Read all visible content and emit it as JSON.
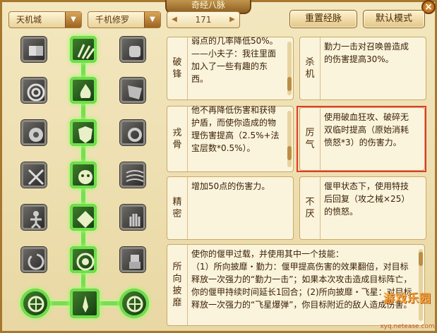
{
  "window": {
    "title": "奇经八脉",
    "close_label": "×"
  },
  "toolbar": {
    "faction_select": "天机城",
    "school_select": "千机修罗",
    "level_value": "171",
    "level_left_arrow": "◀",
    "level_right_arrow": "▶",
    "reset_button": "重置经脉",
    "default_button": "默认模式",
    "dropdown_arrow": "▼"
  },
  "skills": [
    {
      "name": "破锋",
      "text": "弱点的几率降低50%。\n——小夫子：我往里面加入了一些有趣的东西。"
    },
    {
      "name": "杀机",
      "text": "勤力一击对召唤兽造成的伤害提高30%。"
    },
    {
      "name": "戎骨",
      "text": "他不再降低伤害和获得护盾，而使你造成的物理伤害提高（2.5%+法宝层数*0.5%）。"
    },
    {
      "name": "厉气",
      "text": "使用破血狂攻、破碎无双临时提高（原始消耗愤怒*3）的伤害力。"
    },
    {
      "name": "精密",
      "text": "增加50点的伤害力。"
    },
    {
      "name": "不厌",
      "text": "偃甲状态下，使用特技后回复（攻之械×25）的愤怒。"
    },
    {
      "name": "所向披靡",
      "text": "使你的偃甲过载，并使用其中一个技能：\n（1）所向披靡・勤力：偃甲提高伤害的效果翻倍，对目标释放一次强力的“勤力一击”；如果本次攻击造成目标阵亡，你的偃甲持续时间延长1回合；(2)所向披靡・飞星：对目标释放一次强力的“飞星爆弹”，你目标附近的敌人造成伤害。"
    }
  ],
  "watermark": {
    "logo": "游戏乐园",
    "url": "xyq.netease.com"
  },
  "icons": [
    "book-icon",
    "claw-icon",
    "fist-icon",
    "target-icon",
    "fire-icon",
    "shatter-icon",
    "orb-icon",
    "shield-icon",
    "gear-icon",
    "swords-icon",
    "mask-icon",
    "wind-icon",
    "figure-icon",
    "rune-icon",
    "hand-icon",
    "spiral-icon",
    "vortex-icon",
    "golem-icon",
    "wheel-icon",
    "blade-icon",
    "wheel-icon"
  ],
  "colors": {
    "accent": "#7bdc52",
    "highlight_border": "#e23a2a",
    "panel": "#fbf4dc"
  }
}
